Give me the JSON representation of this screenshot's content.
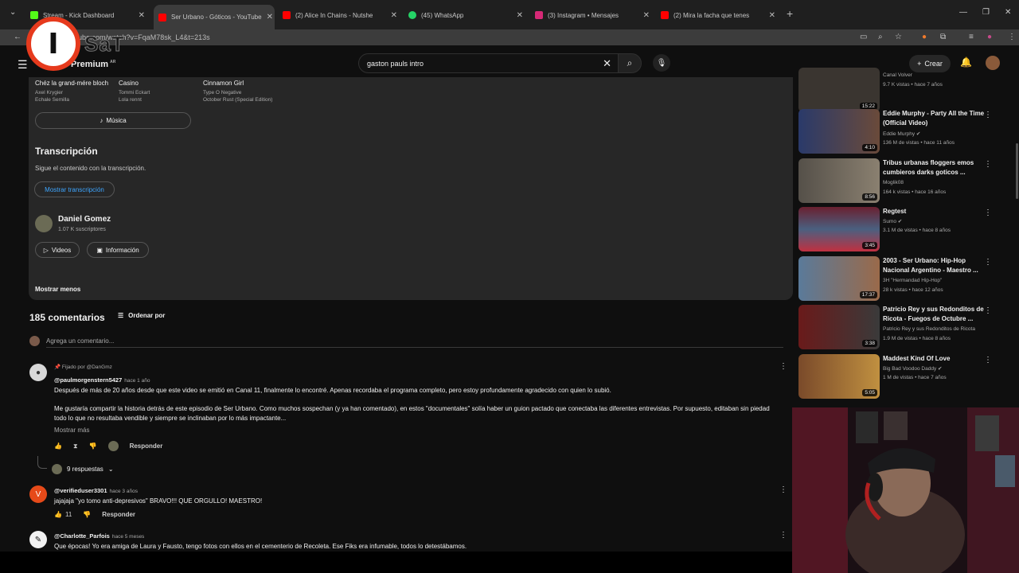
{
  "tabs": [
    {
      "label": "Stream - Kick Dashboard",
      "color": "#53fc18"
    },
    {
      "label": "Ser Urbano - Góticos - YouTube",
      "color": "#ff0000"
    },
    {
      "label": "(2) Alice In Chains - Nutshe",
      "color": "#ff0000"
    },
    {
      "label": "(45) WhatsApp",
      "color": "#25d366"
    },
    {
      "label": "(3) Instagram • Mensajes",
      "color": "#d62976"
    },
    {
      "label": "(2) Mira la facha que tenes",
      "color": "#ff0000"
    }
  ],
  "address": {
    "url": "ube.com/watch?v=FqaM78sk_L4&t=213s"
  },
  "overlay": {
    "logo_letter": "I",
    "logo_text": "SaT"
  },
  "header": {
    "brand": "Premium",
    "brand_region": "AR",
    "search_value": "gaston pauls intro",
    "create_label": "Crear"
  },
  "description": {
    "songs": [
      {
        "title": "Chéz la grand-mére bloch",
        "artist": "Axel Krygier",
        "album": "Echale Semilla"
      },
      {
        "title": "Casino",
        "artist": "Tommi Eckart",
        "album": "Lola rennt"
      },
      {
        "title": "Cinnamon Girl",
        "artist": "Type O Negative",
        "album": "October Rust (Special Edition)"
      }
    ],
    "music_label": "Música",
    "transcript_title": "Transcripción",
    "transcript_desc": "Sigue el contenido con la transcripción.",
    "transcript_button": "Mostrar transcripción",
    "channel_name": "Daniel Gomez",
    "channel_subs": "1.07 K suscriptores",
    "videos_label": "Videos",
    "info_label": "Información",
    "show_less": "Mostrar menos"
  },
  "comments": {
    "count_label": "185 comentarios",
    "sort_label": "Ordenar por",
    "add_placeholder": "Agrega un comentario...",
    "items": [
      {
        "pinned": "Fijado por @DanGmz",
        "author": "@paulmorgenstern5427",
        "time": "hace 1 año",
        "text1": "Después de más de 20 años desde que este video se emitió en Canal 11, finalmente lo encontré. Apenas recordaba el programa completo, pero estoy profundamente agradecido con quien lo subió.",
        "text2": "Me gustaría compartir la historia detrás de este episodio de Ser Urbano. Como muchos sospechan (y ya han comentado), en estos \"documentales\" solía haber un guion pactado que conectaba las diferentes entrevistas. Por supuesto, editaban sin piedad todo lo que no resultaba vendible y siempre se inclinaban por lo más impactante...",
        "more": "Mostrar más",
        "reply_label": "Responder",
        "replies_label": "9 respuestas"
      },
      {
        "avatar_letter": "V",
        "author": "@verifieduser3301",
        "time": "hace 3 años",
        "text1": "jajajaja \"yo tomo anti-depresivos\" BRAVO!!! QUE ORGULLO! MAESTRO!",
        "likes": "11",
        "reply_label": "Responder"
      },
      {
        "author": "@Charlotte_Parfois",
        "time": "hace 5 meses",
        "text1": "Que épocas! Yo era amiga de Laura y Fausto, tengo fotos con ellos en el cementerio de Recoleta. Ese Fiks era infumable, todos lo detestábamos."
      }
    ]
  },
  "sidebar": {
    "videos": [
      {
        "title": "",
        "channel": "Canal Volver",
        "meta": "9.7 K vistas • hace 7 años",
        "duration": "15:22",
        "thumb": "#3a3530"
      },
      {
        "title": "Eddie Murphy - Party All the Time (Official Video)",
        "channel": "Eddie Murphy",
        "meta": "136 M de vistas • hace 11 años",
        "duration": "4:10",
        "thumb": "#2a3a6a"
      },
      {
        "title": "Tribus urbanas floggers emos cumbieros darks goticos ...",
        "channel": "Moglik08",
        "meta": "164 k vistas • hace 16 años",
        "duration": "8:56",
        "thumb": "#555049"
      },
      {
        "title": "Regtest",
        "channel": "Sumo",
        "meta": "3.1 M de vistas • hace 8 años",
        "duration": "3:45",
        "thumb": "#4a6080"
      },
      {
        "title": "2003 - Ser Urbano: Hip-Hop Nacional Argentino - Maestro ...",
        "channel": "3H \"Hermandad Hip-Hop\"",
        "meta": "28 k vistas • hace 12 años",
        "duration": "17:37",
        "thumb": "#5a7a9a"
      },
      {
        "title": "Patricio Rey y sus Redonditos de Ricota - Fuegos de Octubre ...",
        "channel": "Patricio Rey y sus Redonditos de Ricota",
        "meta": "1.9 M de vistas • hace 8 años",
        "duration": "3:38",
        "thumb": "#6a1a1a"
      },
      {
        "title": "Maddest Kind Of Love",
        "channel": "Big Bad Voodoo Daddy",
        "meta": "1 M de vistas • hace 7 años",
        "duration": "5:05",
        "thumb": "#7a4a2a"
      }
    ]
  }
}
